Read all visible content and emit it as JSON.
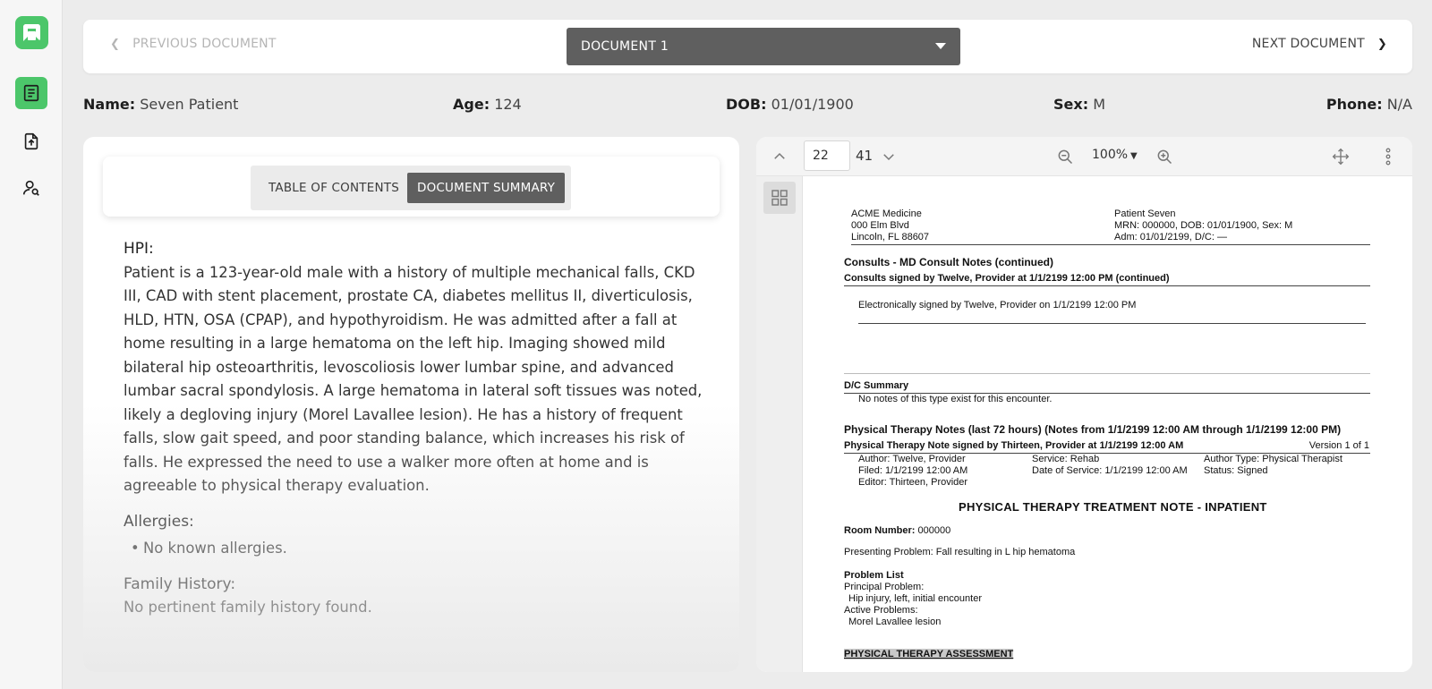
{
  "nav": {
    "prev_label": "PREVIOUS DOCUMENT",
    "next_label": "NEXT DOCUMENT",
    "document_selected": "DOCUMENT 1"
  },
  "patient": {
    "name_label": "Name:",
    "name": "Seven Patient",
    "age_label": "Age:",
    "age": "124",
    "dob_label": "DOB:",
    "dob": "01/01/1900",
    "sex_label": "Sex:",
    "sex": "M",
    "phone_label": "Phone:",
    "phone": "N/A"
  },
  "tabs": {
    "toc": "TABLE OF CONTENTS",
    "summary": "DOCUMENT SUMMARY"
  },
  "summary": {
    "hpi_heading": "HPI:",
    "hpi_text": "Patient is a 123-year-old male with a history of multiple mechanical falls, CKD III, CAD with stent placement, prostate CA, diabetes mellitus II, diverticulosis, HLD, HTN, OSA (CPAP), and hypothyroidism. He was admitted after a fall at home resulting in a large hematoma on the left hip. Imaging showed mild bilateral hip osteoarthritis, levoscoliosis lower lumbar spine, and advanced lumbar sacral spondylosis. A large hematoma in lateral soft tissues was noted, likely a degloving injury (Morel Lavallee lesion). He has a history of frequent falls, slow gait speed, and poor standing balance, which increases his risk of falls. He expressed the need to use a walker more often at home and is agreeable to physical therapy evaluation.",
    "allergies_heading": "Allergies:",
    "allergies": [
      "No known allergies."
    ],
    "family_heading": "Family History:",
    "family_text": "No pertinent family history found."
  },
  "viewer": {
    "page_current": "22",
    "page_total": "41",
    "zoom": "100%"
  },
  "doc_page": {
    "org_name": "ACME Medicine",
    "org_addr1": "000 Elm Blvd",
    "org_addr2": "Lincoln, FL 88607",
    "pt_name": "Patient Seven",
    "pt_mrn": "MRN: 000000, DOB: 01/01/1900, Sex: M",
    "pt_adm": "Adm: 01/01/2199, D/C: —",
    "consults_heading": "Consults - MD Consult Notes (continued)",
    "consults_signed": "Consults signed by Twelve, Provider at 1/1/2199 12:00 PM (continued)",
    "esigned": "Electronically signed by Twelve, Provider on 1/1/2199 12:00 PM",
    "dc_heading": "D/C Summary",
    "dc_text": "No notes of this type exist for this encounter.",
    "pt_notes_heading": "Physical Therapy Notes (last 72 hours) (Notes from 1/1/2199 12:00 AM through 1/1/2199 12:00 PM)",
    "pt_note_signed": "Physical Therapy Note signed by Thirteen, Provider at 1/1/2199 12:00 AM",
    "version": "Version 1 of 1",
    "author": "Author: Twelve, Provider",
    "filed": "Filed: 1/1/2199 12:00 AM",
    "editor": "Editor: Thirteen, Provider",
    "service": "Service: Rehab",
    "date_service": "Date of Service: 1/1/2199 12:00 AM",
    "author_type": "Author Type: Physical Therapist",
    "status": "Status: Signed",
    "treatment_title": "PHYSICAL THERAPY TREATMENT NOTE - INPATIENT",
    "room_label": "Room Number:",
    "room_value": "000000",
    "presenting": "Presenting Problem: Fall resulting in L hip hematoma",
    "problem_list": "Problem List",
    "principal_label": "Principal Problem:",
    "principal_value": "Hip injury, left, initial encounter",
    "active_label": "Active Problems:",
    "active_value": "Morel Lavallee lesion",
    "assessment_heading": "PHYSICAL THERAPY ASSESSMENT"
  },
  "colors": {
    "accent": "#4cc66a",
    "dark_control": "#5f5f5f"
  }
}
